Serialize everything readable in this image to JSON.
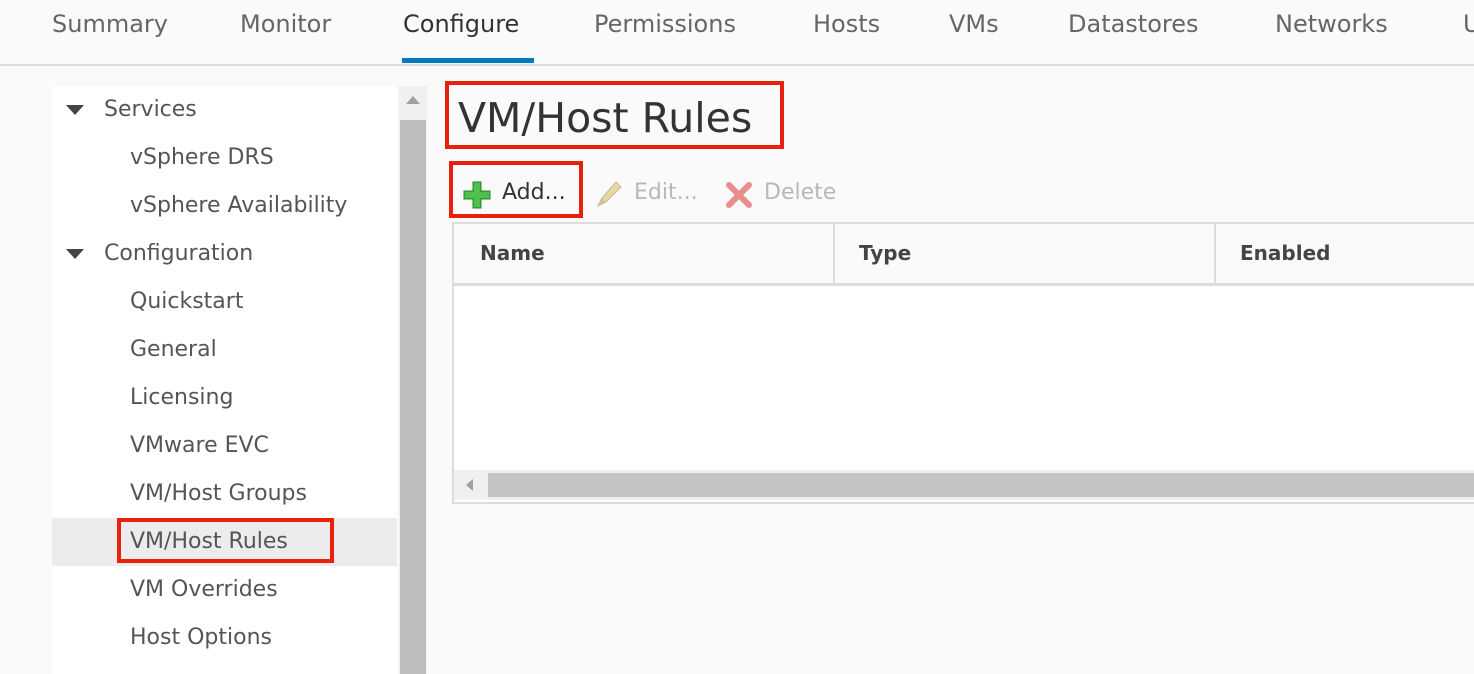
{
  "tabs": [
    {
      "label": "Summary"
    },
    {
      "label": "Monitor"
    },
    {
      "label": "Configure",
      "active": true
    },
    {
      "label": "Permissions"
    },
    {
      "label": "Hosts"
    },
    {
      "label": "VMs"
    },
    {
      "label": "Datastores"
    },
    {
      "label": "Networks"
    },
    {
      "label": "U"
    }
  ],
  "tree": {
    "groups": [
      {
        "label": "Services",
        "expanded": true,
        "items": [
          "vSphere DRS",
          "vSphere Availability"
        ]
      },
      {
        "label": "Configuration",
        "expanded": true,
        "items": [
          "Quickstart",
          "General",
          "Licensing",
          "VMware EVC",
          "VM/Host Groups",
          "VM/Host Rules",
          "VM Overrides",
          "Host Options"
        ]
      }
    ],
    "selected": "VM/Host Rules"
  },
  "page": {
    "title": "VM/Host Rules"
  },
  "toolbar": {
    "add_label": "Add...",
    "edit_label": "Edit...",
    "delete_label": "Delete"
  },
  "grid": {
    "columns": [
      "Name",
      "Type",
      "Enabled"
    ],
    "rows": []
  },
  "colors": {
    "accent": "#0079b8",
    "highlight_box": "#e8210c",
    "add_icon": "#3cae3c",
    "delete_icon": "#e88c8c"
  },
  "icons": {
    "add": "plus-icon",
    "edit": "pencil-icon",
    "delete": "x-icon",
    "caret": "caret-down-icon"
  }
}
